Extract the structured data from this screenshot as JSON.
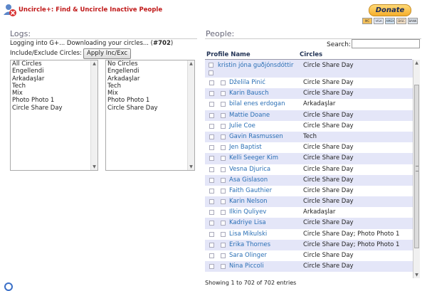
{
  "header": {
    "title": "Uncircle+: Find & Uncircle Inactive People",
    "donate_label": "Donate",
    "payment_cards": [
      "MC",
      "VISA",
      "AMEX",
      "DISC",
      "BANK"
    ]
  },
  "logs": {
    "title": "Logs:",
    "status_text": "Logging into G+... Downloading your circles... (",
    "status_count": "#702",
    "status_suffix": ")",
    "incexc_label": "Include/Exclude Circles:",
    "apply_button": "Apply Inc/Exc",
    "include_options": [
      "All Circles",
      "Engellendi",
      "Arkadaşlar",
      "Tech",
      "Mix",
      "Photo Photo 1",
      "Circle Share Day"
    ],
    "exclude_options": [
      "No Circles",
      "Engellendi",
      "Arkadaşlar",
      "Tech",
      "Mix",
      "Photo Photo 1",
      "Circle Share Day"
    ]
  },
  "people": {
    "title": "People:",
    "search_label": "Search:",
    "search_value": "",
    "columns": [
      "Profile Name",
      "Circles"
    ],
    "rows": [
      {
        "name": "kristin jóna guðjónsdóttir",
        "circles": "Circle Share Day"
      },
      {
        "name": "Dželila Pinić",
        "circles": "Circle Share Day"
      },
      {
        "name": "Karin Bausch",
        "circles": "Circle Share Day"
      },
      {
        "name": "bilal enes erdogan",
        "circles": "Arkadaşlar"
      },
      {
        "name": "Mattie Doane",
        "circles": "Circle Share Day"
      },
      {
        "name": "Julie Coe",
        "circles": "Circle Share Day"
      },
      {
        "name": "Gavin Rasmussen",
        "circles": "Tech"
      },
      {
        "name": "Jen Baptist",
        "circles": "Circle Share Day"
      },
      {
        "name": "Kelli Seeger Kim",
        "circles": "Circle Share Day"
      },
      {
        "name": "Vesna Djurica",
        "circles": "Circle Share Day"
      },
      {
        "name": "Asa Gislason",
        "circles": "Circle Share Day"
      },
      {
        "name": "Faith Gauthier",
        "circles": "Circle Share Day"
      },
      {
        "name": "Karin Nelson",
        "circles": "Circle Share Day"
      },
      {
        "name": "Ilkin Quliyev",
        "circles": "Arkadaşlar"
      },
      {
        "name": "Kadriye Lisa",
        "circles": "Circle Share Day"
      },
      {
        "name": "Lisa Mikulski",
        "circles": "Circle Share Day; Photo Photo 1"
      },
      {
        "name": "Erika Thornes",
        "circles": "Circle Share Day; Photo Photo 1"
      },
      {
        "name": "Sara Olinger",
        "circles": "Circle Share Day"
      },
      {
        "name": "Nina Piccoli",
        "circles": "Circle Share Day"
      }
    ],
    "info_text": "Showing 1 to 702 of 702 entries"
  }
}
